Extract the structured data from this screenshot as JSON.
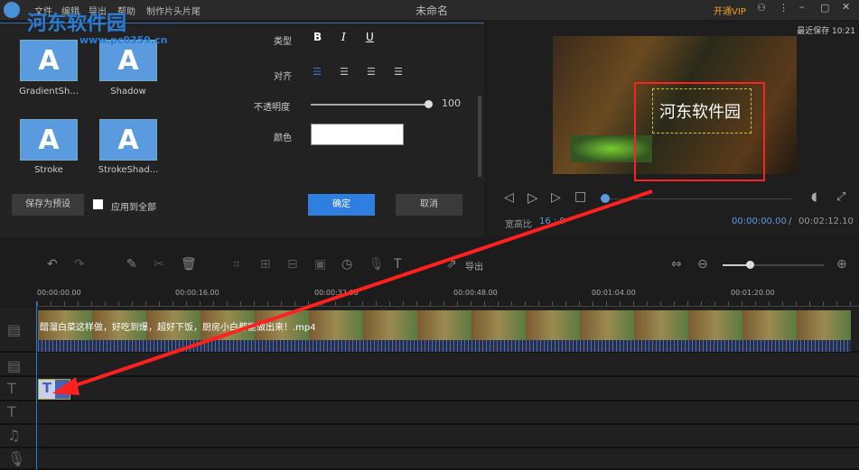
{
  "titlebar": {
    "menus": [
      "文件",
      "编辑",
      "导出",
      "帮助",
      "制作片头片尾"
    ],
    "title": "未命名",
    "vip": "开通VIP",
    "watermark": "河东软件园",
    "watermark_url": "www.pc0359.cn"
  },
  "styles": [
    {
      "label": "GradientSh..."
    },
    {
      "label": "Shadow"
    },
    {
      "label": "Stroke"
    },
    {
      "label": "StrokeShad..."
    }
  ],
  "props": {
    "type_label": "类型",
    "bold": "B",
    "italic": "I",
    "underline": "U",
    "align_label": "对齐",
    "opacity_label": "不透明度",
    "opacity_value": "100",
    "color_label": "颜色",
    "color_value": "#ffffff"
  },
  "buttons": {
    "save_preset": "保存为预设",
    "apply_all": "应用到全部",
    "ok": "确定",
    "cancel": "取消"
  },
  "preview": {
    "last_saved": "最近保存 10:21",
    "overlay_text": "河东软件园",
    "aspect_label": "宽高比",
    "aspect_value": "16 : 9",
    "current_time": "00:00:00.00",
    "separator": "/",
    "total_time": "00:02:12.10",
    "progress": 0
  },
  "toolbar": {
    "export": "导出",
    "zoom_level": 0.2
  },
  "ruler": [
    "00:00:00.00",
    "00:00:16.00",
    "00:00:32.00",
    "00:00:48.00",
    "00:01:04.00",
    "00:01:20.00"
  ],
  "clip": {
    "name": "醋溜白菜这样做，好吃到爆，超好下饭，厨房小白都能做出来！.mp4"
  },
  "colors": {
    "accent": "#2f7fe0",
    "annotation": "#ff2020"
  }
}
